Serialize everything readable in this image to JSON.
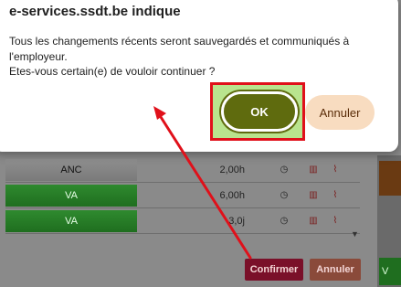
{
  "dialog": {
    "title": "e-services.ssdt.be indique",
    "message_lines": [
      "Tous les changements récents seront sauvegardés et communiqués à",
      "l'employeur.",
      "Etes-vous certain(e) de vouloir continuer ?"
    ],
    "ok_label": "OK",
    "cancel_label": "Annuler"
  },
  "background": {
    "rows": [
      {
        "type": "ANC",
        "value": "2,00h"
      },
      {
        "type": "VA",
        "value": "6,00h"
      },
      {
        "type": "VA",
        "value": "3,0j"
      }
    ],
    "confirm_label": "Confirmer",
    "cancel_label": "Annuler",
    "right_strip_label": "V"
  },
  "icons": {
    "clock": "clock-icon",
    "trash": "trash-icon",
    "attach": "paperclip-icon",
    "scroll": "scroll-down-icon"
  },
  "colors": {
    "ok_bg": "#5f6b0e",
    "cancel_bg": "#f8dcc0",
    "highlight": "#e0101a",
    "confirm_bg": "#7a1029"
  }
}
